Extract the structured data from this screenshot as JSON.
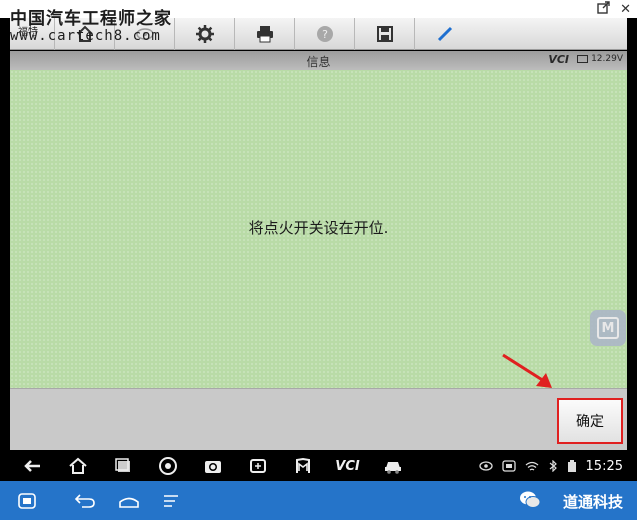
{
  "watermark": {
    "line1": "中国汽车工程师之家",
    "line2": "www.cartech8.com"
  },
  "window": {
    "popout_icon": "popout-icon",
    "close_label": "✕"
  },
  "toolbar": {
    "brand_label": "福特",
    "buttons": [
      {
        "name": "home-icon"
      },
      {
        "name": "remote-icon"
      },
      {
        "name": "gear-icon"
      },
      {
        "name": "printer-icon"
      },
      {
        "name": "help-icon"
      },
      {
        "name": "save-icon"
      },
      {
        "name": "pen-icon"
      }
    ]
  },
  "infobar": {
    "title": "信息",
    "vcl": "VCI",
    "voltage": "12.29V"
  },
  "message": {
    "text": "将点火开关设在开位."
  },
  "actions": {
    "ok_label": "确定"
  },
  "navbar": {
    "items": [
      "back-icon",
      "home-icon",
      "recents-icon",
      "chrome-icon",
      "camera-icon",
      "screenshot-icon",
      "maxi-icon",
      "vci-icon",
      "car-icon"
    ],
    "vcl_label": "VCI",
    "time": "15:25"
  },
  "bottom": {
    "brand": "道通科技"
  },
  "colors": {
    "message_bg": "#b9dba7",
    "highlight": "#e02020",
    "bottom_bar": "#2574c9"
  }
}
